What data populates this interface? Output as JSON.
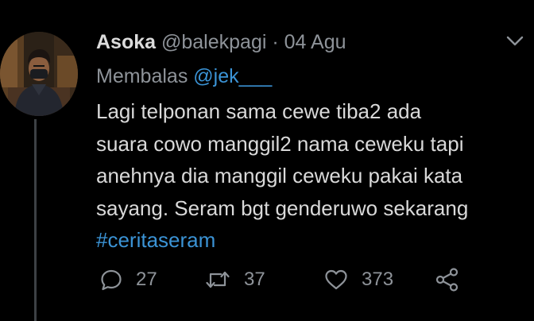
{
  "tweet": {
    "author_name": "Asoka",
    "handle": "@balekpagi",
    "separator": "·",
    "date": "04 Agu",
    "reply_prefix": "Membalas",
    "reply_mention": "@jek___",
    "text_lines": [
      "Lagi telponan sama cewe tiba2 ada",
      "suara cowo manggil2 nama ceweku tapi",
      "anehnya dia manggil ceweku pakai kata",
      "sayang. Seram bgt genderuwo sekarang"
    ],
    "hashtag": "#ceritaseram",
    "actions": {
      "reply_count": "27",
      "retweet_count": "37",
      "like_count": "373"
    }
  },
  "icons": {
    "menu": "chevron-down-icon",
    "reply": "speech-bubble-icon",
    "retweet": "retweet-arrows-icon",
    "like": "heart-outline-icon",
    "share": "share-nodes-icon"
  },
  "colors": {
    "background": "#000000",
    "text": "#d9d9d9",
    "muted": "#8e9399",
    "link": "#3b93d5",
    "thread_line": "#3d4145"
  }
}
